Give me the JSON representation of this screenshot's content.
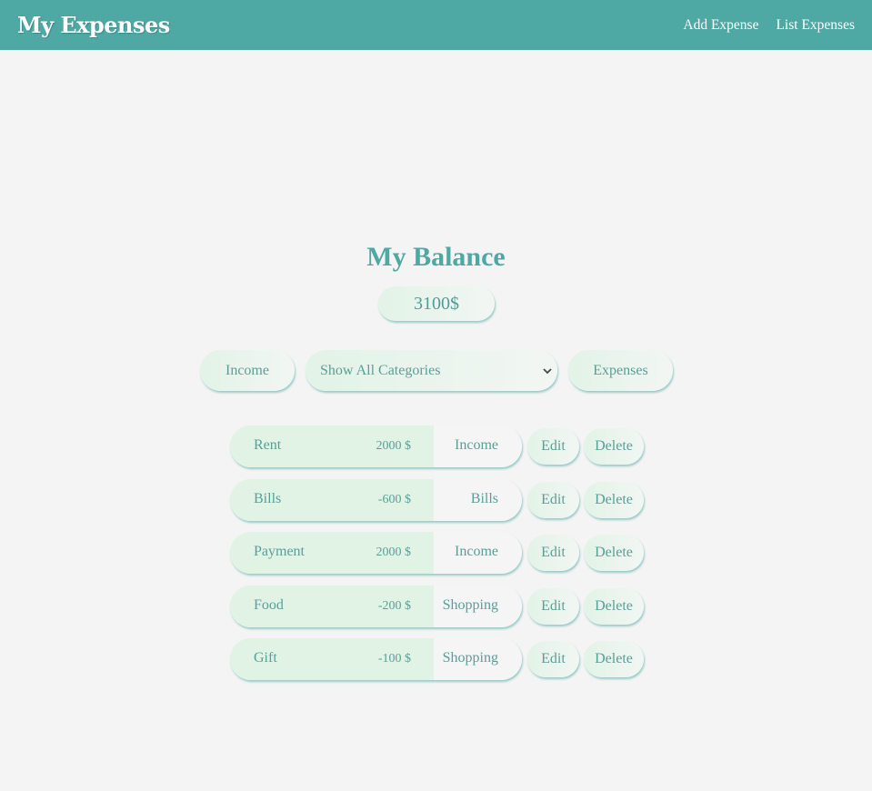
{
  "navbar": {
    "brand": "My Expenses",
    "links": [
      "Add Expense",
      "List Expenses"
    ]
  },
  "balance": {
    "title": "My Balance",
    "value": "3100$"
  },
  "filters": {
    "income_label": "Income",
    "category_select": "Show All Categories",
    "expenses_label": "Expenses"
  },
  "items": [
    {
      "name": "Rent",
      "amount": "2000 $",
      "category": "Income"
    },
    {
      "name": "Bills",
      "amount": "-600 $",
      "category": "Bills"
    },
    {
      "name": "Payment",
      "amount": "2000 $",
      "category": "Income"
    },
    {
      "name": "Food",
      "amount": "-200 $",
      "category": "Shopping"
    },
    {
      "name": "Gift",
      "amount": "-100 $",
      "category": "Shopping"
    }
  ],
  "actions": {
    "edit": "Edit",
    "delete": "Delete"
  },
  "colors": {
    "navbar": "#4ea8a4",
    "background": "#f4f4f4",
    "pill_fill": "#e0f3e5",
    "text": "#5a9e9a"
  }
}
